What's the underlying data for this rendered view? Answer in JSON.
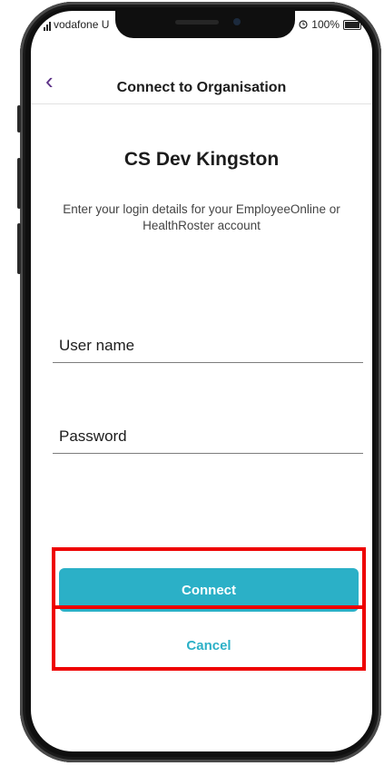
{
  "status_bar": {
    "carrier": "vodafone U",
    "battery": "100%",
    "alarm_icon": "alarm-clock-icon",
    "signal_icon": "signal-bars-icon",
    "battery_icon": "battery-icon"
  },
  "header": {
    "back_icon": "chevron-left-icon",
    "back_glyph": "‹",
    "title": "Connect to Organisation"
  },
  "organisation": {
    "name": "CS Dev Kingston",
    "instructions": "Enter your login details for your EmployeeOnline or HealthRoster account"
  },
  "form": {
    "username_placeholder": "User name",
    "username_value": "",
    "password_placeholder": "Password",
    "password_value": ""
  },
  "actions": {
    "connect_label": "Connect",
    "cancel_label": "Cancel"
  },
  "colors": {
    "accent": "#2bb0c7",
    "back_chevron": "#5b2f86",
    "highlight": "#ee0000"
  }
}
